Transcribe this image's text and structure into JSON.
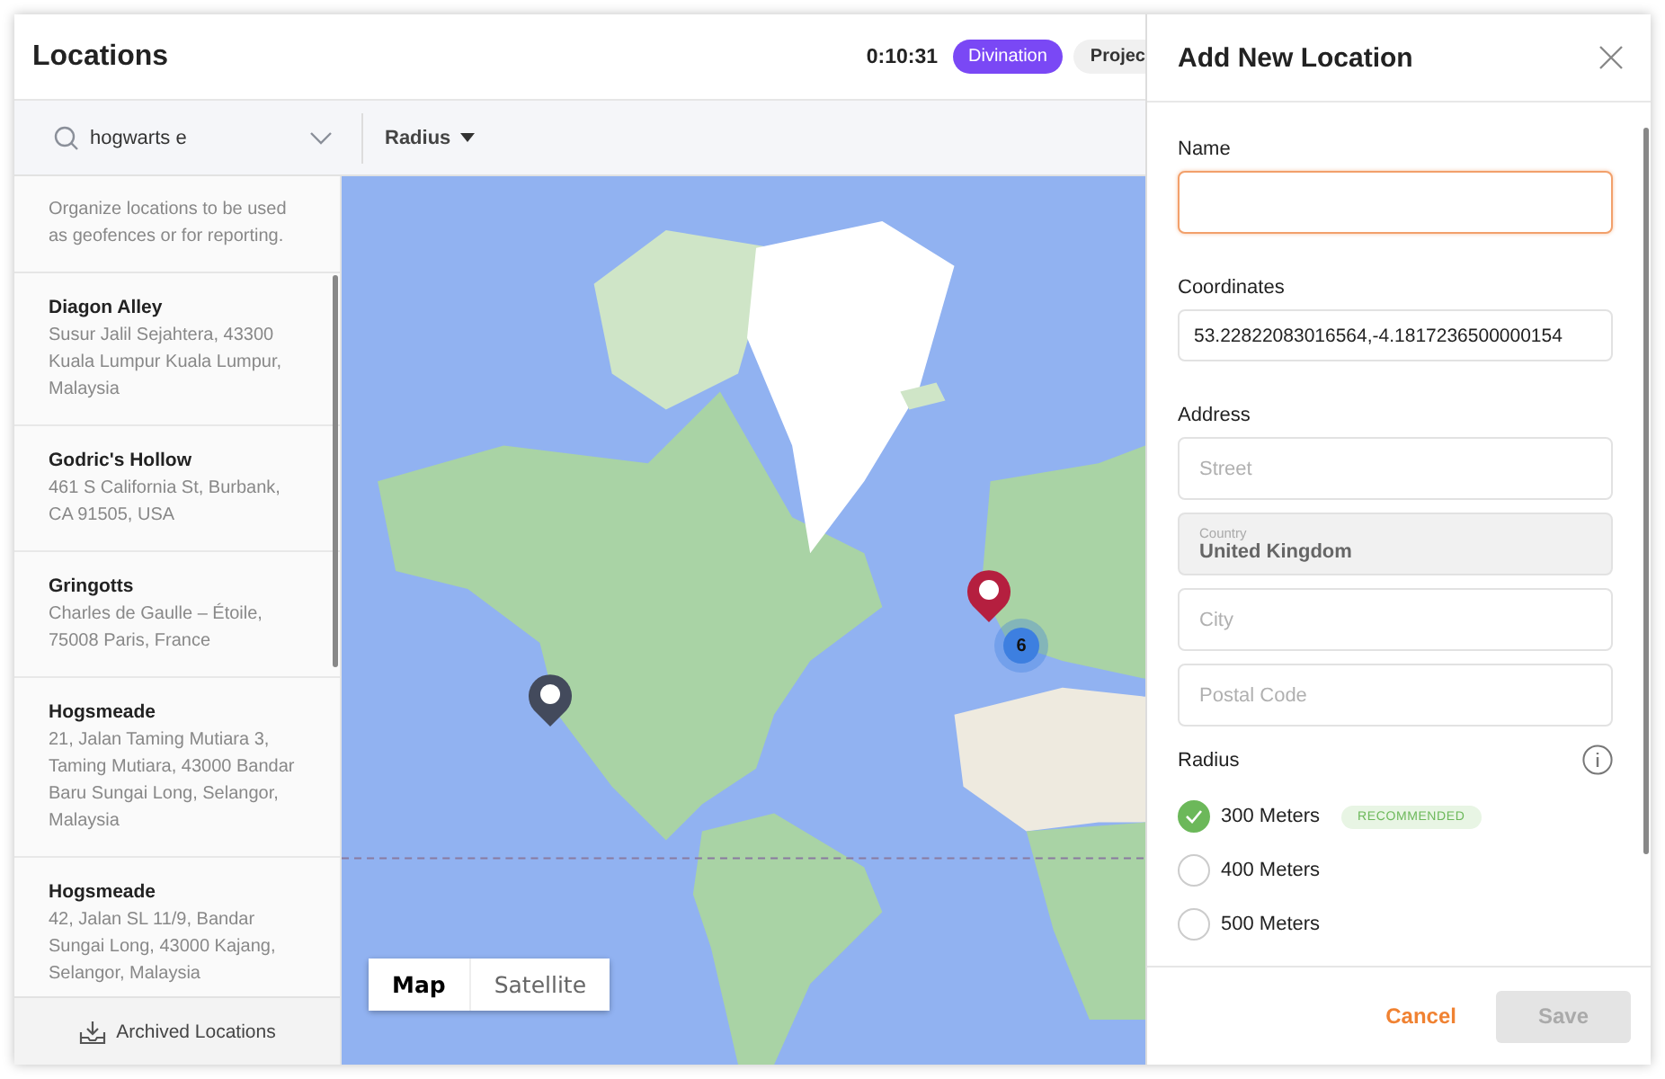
{
  "header": {
    "title": "Locations",
    "timer": "0:10:31",
    "tags": [
      {
        "label": "Divination",
        "selected": true
      },
      {
        "label": "Projec",
        "selected": false
      }
    ]
  },
  "toolbar": {
    "search": {
      "value": "hogwarts e"
    },
    "filter": {
      "label": "Radius"
    }
  },
  "sidebar": {
    "description": "Organize locations to be used as geofences or for reporting.",
    "items": [
      {
        "name": "Diagon Alley",
        "address": "Susur Jalil Sejahtera, 43300 Kuala Lumpur Kuala Lumpur, Malaysia"
      },
      {
        "name": "Godric's Hollow",
        "address": "461 S California St, Burbank, CA 91505, USA"
      },
      {
        "name": "Gringotts",
        "address": "Charles de Gaulle – Étoile, 75008 Paris, France"
      },
      {
        "name": "Hogsmeade",
        "address": "21, Jalan Taming Mutiara 3, Taming Mutiara, 43000 Bandar Baru Sungai Long, Selangor, Malaysia"
      },
      {
        "name": "Hogsmeade",
        "address": "42, Jalan SL 11/9, Bandar Sungai Long, 43000 Kajang, Selangor, Malaysia"
      }
    ],
    "footer_link": "Archived Locations"
  },
  "map": {
    "kind": "picture",
    "markers": [
      {
        "kind": "pin",
        "color": "#434a5c"
      },
      {
        "kind": "pin",
        "color": "#b51f3f"
      },
      {
        "kind": "cluster",
        "label": "6"
      }
    ],
    "map_types": [
      {
        "label": "Map",
        "selected": true
      },
      {
        "label": "Satellite",
        "selected": false
      }
    ]
  },
  "panel": {
    "title": "Add New Location",
    "name": {
      "label": "Name",
      "focused": true
    },
    "coordinates": {
      "label": "Coordinates",
      "value": "53.22822083016564,-4.1817236500000154"
    },
    "address": {
      "label": "Address",
      "fields": [
        {
          "placeholder": "Street",
          "disabled": false
        },
        {
          "label": "Country",
          "value": "United Kingdom",
          "disabled": true
        },
        {
          "placeholder": "City",
          "disabled": false
        },
        {
          "placeholder": "Postal Code",
          "disabled": false
        }
      ]
    },
    "radius": {
      "label": "Radius",
      "options": [
        {
          "label": "300 Meters",
          "selected": true,
          "badge": "RECOMMENDED"
        },
        {
          "label": "400 Meters",
          "selected": false
        },
        {
          "label": "500 Meters",
          "selected": false
        }
      ]
    },
    "cancel": "Cancel",
    "save": {
      "label": "Save",
      "disabled": true
    }
  }
}
